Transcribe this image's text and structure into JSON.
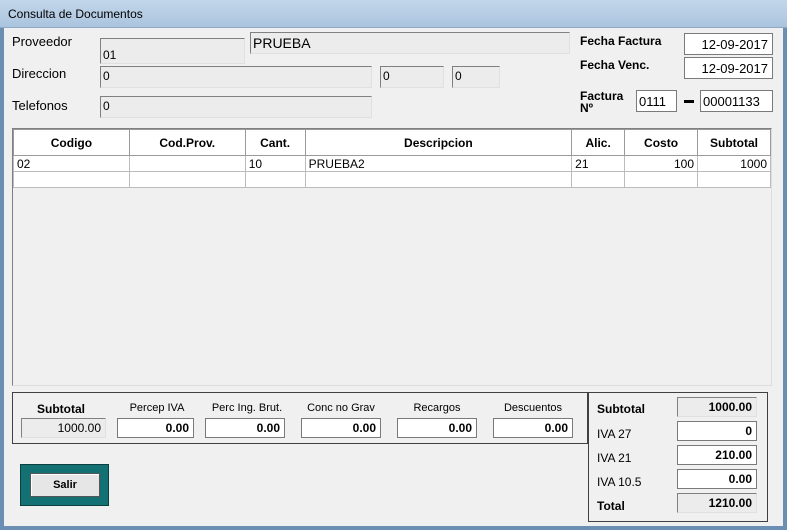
{
  "window": {
    "title": "Consulta de Documentos"
  },
  "header": {
    "proveedor_label": "Proveedor",
    "proveedor_code": "01",
    "proveedor_name": "PRUEBA",
    "direccion_label": "Direccion",
    "direccion": "0",
    "direccion_2": "0",
    "direccion_3": "0",
    "telefonos_label": "Telefonos",
    "telefonos": "0",
    "fecha_factura_label": "Fecha Factura",
    "fecha_factura": "12-09-2017",
    "fecha_venc_label": "Fecha Venc.",
    "fecha_venc": "12-09-2017",
    "factura_label_1": "Factura",
    "factura_label_2": "Nº",
    "factura_pv": "0111",
    "factura_num": "00001133"
  },
  "grid": {
    "columns": [
      "Codigo",
      "Cod.Prov.",
      "Cant.",
      "Descripcion",
      "Alic.",
      "Costo",
      "Subtotal"
    ],
    "rows": [
      [
        "02",
        "",
        "10",
        "PRUEBA2",
        "21",
        "100",
        "1000"
      ],
      [
        "",
        "",
        "",
        "",
        "",
        "",
        ""
      ]
    ]
  },
  "totals_bar": {
    "subtotal_label": "Subtotal",
    "subtotal": "1000.00",
    "percep_iva_label": "Percep  IVA",
    "percep_iva": "0.00",
    "perc_ib_label": "Perc  Ing. Brut.",
    "perc_ib": "0.00",
    "conc_no_grav_label": "Conc no Grav",
    "conc_no_grav": "0.00",
    "recargos_label": "Recargos",
    "recargos": "0.00",
    "descuentos_label": "Descuentos",
    "descuentos": "0.00"
  },
  "summary": {
    "subtotal_label": "Subtotal",
    "subtotal": "1000.00",
    "iva27_label": "IVA 27",
    "iva27": "0",
    "iva21_label": "IVA 21",
    "iva21": "210.00",
    "iva105_label": "IVA 10.5",
    "iva105": "0.00",
    "total_label": "Total",
    "total": "1210.00"
  },
  "actions": {
    "salir_label": "Salir"
  }
}
